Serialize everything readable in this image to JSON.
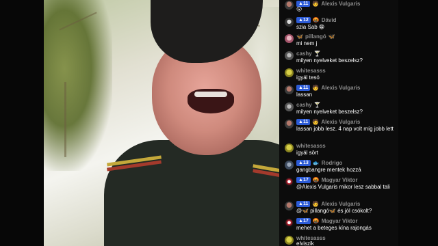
{
  "chat": {
    "messages": [
      {
        "user": "Alexis Vulgaris",
        "badge": "11",
        "badge_emoji": "🧑",
        "text": "😮",
        "avatar": "dark"
      },
      {
        "user": "Dávid",
        "badge": "12",
        "badge_emoji": "🤬",
        "text": "szia Sab 😁",
        "avatar": "bw"
      },
      {
        "user": "pillangó",
        "badge": "",
        "badge_emoji": "",
        "text": "mi nem j",
        "avatar": "pink",
        "suffix": "🦋"
      },
      {
        "user": "cashy",
        "badge": "",
        "badge_emoji": "",
        "text": "milyen nyelveket beszelsz?",
        "avatar": "gray",
        "suffix": "🍸"
      },
      {
        "user": "whitesasss",
        "badge": "",
        "badge_emoji": "",
        "text": "igyál tesó",
        "avatar": "yellow"
      },
      {
        "user": "Alexis Vulgaris",
        "badge": "11",
        "badge_emoji": "🧑",
        "text": "lassan",
        "avatar": "dark"
      },
      {
        "user": "cashy",
        "badge": "",
        "badge_emoji": "",
        "text": "milyen nyelveket beszelsz?",
        "avatar": "gray",
        "suffix": "🍸"
      },
      {
        "user": "Alexis Vulgaris",
        "badge": "11",
        "badge_emoji": "🧑",
        "text": "lassan jobb lesz. 4 nap volt míg jobb lett",
        "avatar": "dark"
      },
      {
        "user": "whitesasss",
        "badge": "",
        "badge_emoji": "",
        "text": "igyál sört",
        "avatar": "yellow"
      },
      {
        "user": "Rodrigo",
        "badge": "13",
        "badge_emoji": "🐟",
        "text": "gangbangre mentek hozzá",
        "avatar": "blue"
      },
      {
        "user": "Magyar Viktor",
        "badge": "17",
        "badge_emoji": "🤬",
        "text": "@Alexis Vulgaris mikor lesz sabbal tali",
        "avatar": "red"
      },
      {
        "user": "Alexis Vulgaris",
        "badge": "11",
        "badge_emoji": "🧑",
        "text": "@🦋 pillangó🦋 és jól csókolt?",
        "avatar": "dark"
      },
      {
        "user": "Magyar Viktor",
        "badge": "17",
        "badge_emoji": "🤬",
        "text": "mehet a beteges kína rajongás",
        "avatar": "red"
      },
      {
        "user": "whitesasss",
        "badge": "",
        "badge_emoji": "",
        "text": "elviszik",
        "avatar": "yellow"
      }
    ]
  },
  "colors": {
    "chat_bg": "#0c0c0c",
    "username": "#8d8d8d",
    "badge": "#2c5bd6",
    "message_text": "#ffffff"
  }
}
